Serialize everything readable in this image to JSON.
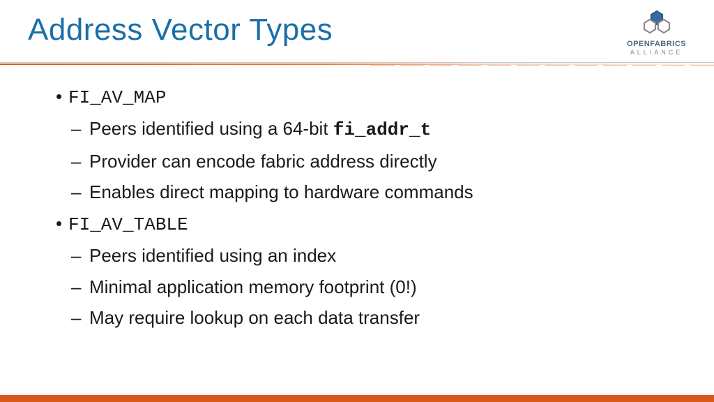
{
  "title": "Address Vector Types",
  "logo": {
    "top": "OPENFABRICS",
    "bottom": "ALLIANCE"
  },
  "bullets": [
    {
      "label": "FI_AV_MAP",
      "sub": [
        {
          "prefix": "Peers identified using a 64-bit ",
          "code": "fi_addr_t"
        },
        {
          "text": "Provider can encode fabric address directly"
        },
        {
          "text": "Enables direct mapping to hardware commands"
        }
      ]
    },
    {
      "label": "FI_AV_TABLE",
      "sub": [
        {
          "text": "Peers identified using an index"
        },
        {
          "text": "Minimal application memory footprint (0!)"
        },
        {
          "text": "May require lookup on each data transfer"
        }
      ]
    }
  ]
}
